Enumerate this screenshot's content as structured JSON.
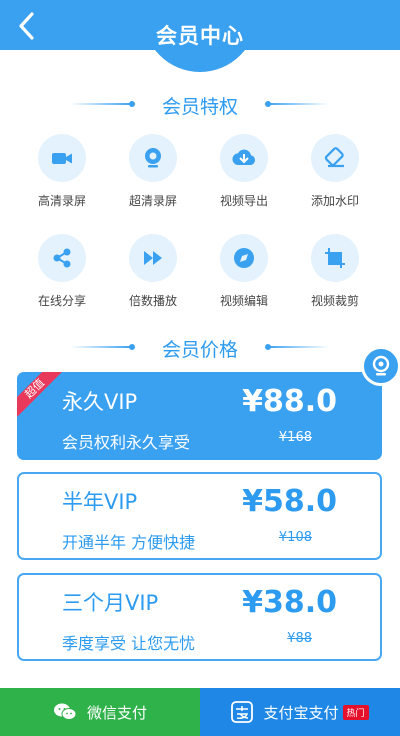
{
  "header": {
    "title": "会员中心",
    "back_icon": "chevron-left-icon"
  },
  "privileges": {
    "title": "会员特权",
    "items": [
      {
        "label": "高清录屏",
        "icon": "video-camera-icon"
      },
      {
        "label": "超清录屏",
        "icon": "webcam-icon"
      },
      {
        "label": "视频导出",
        "icon": "cloud-download-icon"
      },
      {
        "label": "添加水印",
        "icon": "eraser-icon"
      },
      {
        "label": "在线分享",
        "icon": "share-icon"
      },
      {
        "label": "倍数播放",
        "icon": "fast-forward-icon"
      },
      {
        "label": "视频编辑",
        "icon": "edit-swirl-icon"
      },
      {
        "label": "视频裁剪",
        "icon": "crop-icon"
      }
    ]
  },
  "pricing": {
    "title": "会员价格",
    "plans": [
      {
        "name": "永久VIP",
        "desc": "会员权利永久享受",
        "price": "¥88.0",
        "original": "¥168",
        "badge": "超值",
        "selected": true
      },
      {
        "name": "半年VIP",
        "desc": "开通半年 方便快捷",
        "price": "¥58.0",
        "original": "¥108",
        "selected": false
      },
      {
        "name": "三个月VIP",
        "desc": "季度享受 让您无忧",
        "price": "¥38.0",
        "original": "¥88",
        "selected": false
      }
    ]
  },
  "payment": {
    "wechat_label": "微信支付",
    "alipay_label": "支付宝支付",
    "hot_label": "热门"
  },
  "colors": {
    "primary": "#3aa0f0",
    "wechat": "#2fb24a",
    "alipay": "#1f88e6",
    "badge": "#e8395a"
  }
}
